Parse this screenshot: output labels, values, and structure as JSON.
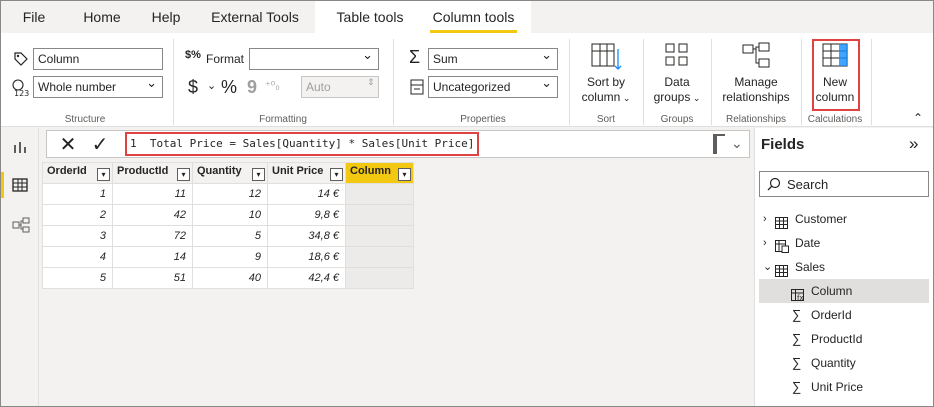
{
  "tabs": {
    "file": "File",
    "home": "Home",
    "help": "Help",
    "external_tools": "External Tools",
    "table_tools": "Table tools",
    "column_tools": "Column tools"
  },
  "ribbon": {
    "structure": {
      "name_value": "Column",
      "datatype_value": "Whole number",
      "group_label": "Structure"
    },
    "formatting": {
      "format_label": "Format",
      "format_value": "",
      "decimals_value": "Auto",
      "currency_symbol": "$",
      "percent_symbol": "%",
      "comma_symbol": "9",
      "group_label": "Formatting"
    },
    "properties": {
      "summarization_value": "Sum",
      "category_value": "Uncategorized",
      "group_label": "Properties"
    },
    "sort": {
      "button_line1": "Sort by",
      "button_line2": "column",
      "group_label": "Sort"
    },
    "groups": {
      "button_line1": "Data",
      "button_line2": "groups",
      "group_label": "Groups"
    },
    "relationships": {
      "button_line1": "Manage",
      "button_line2": "relationships",
      "group_label": "Relationships"
    },
    "calculations": {
      "button_line1": "New",
      "button_line2": "column",
      "group_label": "Calculations"
    },
    "collapse_glyph": "⌃"
  },
  "formula_bar": {
    "cancel_glyph": "✕",
    "commit_glyph": "✓",
    "line_number": "1",
    "formula": "Total Price = Sales[Quantity] * Sales[Unit Price]"
  },
  "table": {
    "columns": [
      "OrderId",
      "ProductId",
      "Quantity",
      "Unit Price",
      "Column"
    ],
    "rows": [
      [
        "1",
        "11",
        "12",
        "14 €",
        ""
      ],
      [
        "2",
        "42",
        "10",
        "9,8 €",
        ""
      ],
      [
        "3",
        "72",
        "5",
        "34,8 €",
        ""
      ],
      [
        "4",
        "14",
        "9",
        "18,6 €",
        ""
      ],
      [
        "5",
        "51",
        "40",
        "42,4 €",
        ""
      ]
    ]
  },
  "fields_pane": {
    "title": "Fields",
    "search_placeholder": "Search",
    "tables": [
      {
        "name": "Customer",
        "expanded": false
      },
      {
        "name": "Date",
        "expanded": false
      },
      {
        "name": "Sales",
        "expanded": true
      }
    ],
    "sales_fields": [
      {
        "name": "Column",
        "icon": "calculated-column-icon",
        "selected": true
      },
      {
        "name": "OrderId",
        "icon": "sigma-icon",
        "selected": false
      },
      {
        "name": "ProductId",
        "icon": "sigma-icon",
        "selected": false
      },
      {
        "name": "Quantity",
        "icon": "sigma-icon",
        "selected": false
      },
      {
        "name": "Unit Price",
        "icon": "sigma-icon",
        "selected": false
      }
    ]
  },
  "colors": {
    "accent_yellow": "#f2c811",
    "highlight_red": "#e04141"
  }
}
